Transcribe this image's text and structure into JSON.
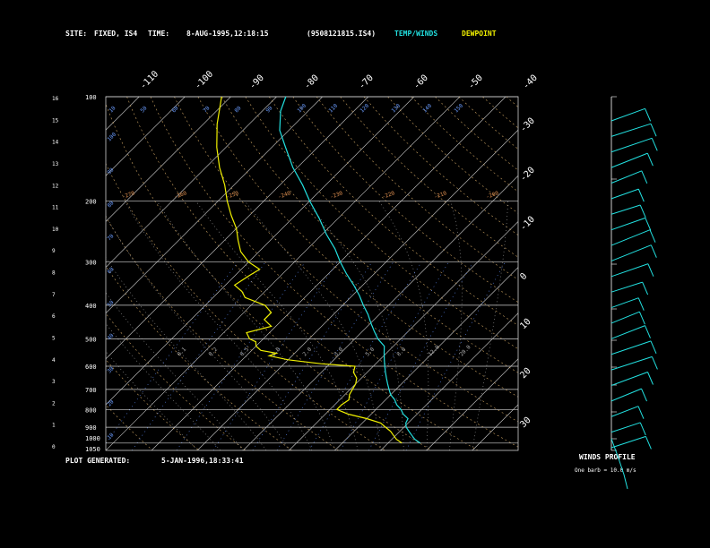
{
  "header": {
    "site_label": "SITE:",
    "site_value": "FIXED, IS4",
    "time_label": "TIME:",
    "time_value": "8-AUG-1995,12:18:15",
    "file_id": "(9508121815.IS4)",
    "legend_temp": "TEMP/WINDS",
    "legend_dew": "DEWPOINT"
  },
  "footer": {
    "generated_label": "PLOT GENERATED:",
    "generated_value": "5-JAN-1996,18:33:41",
    "winds_title": "WINDS PROFILE",
    "winds_note": "One barb = 10.0 m/s"
  },
  "colors": {
    "temp": "#22e0e0",
    "dewpoint": "#f0f000",
    "isotherm": "#cfcfcf",
    "dry_adiabat": "#c8a060",
    "moist_adiabat": "#a0a0a0",
    "mixing_ratio": "#6090ff",
    "isobar": "#cfcfcf"
  },
  "chart_data": {
    "type": "line",
    "subtype": "skew-T log-P sounding",
    "pressure_ticks": [
      "100",
      "200",
      "300",
      "400",
      "500",
      "600",
      "700",
      "800",
      "900",
      "1000",
      "1050"
    ],
    "height_ticks": [
      "0",
      "1",
      "2",
      "3",
      "4",
      "5",
      "6",
      "7",
      "8",
      "9",
      "10",
      "11",
      "12",
      "13",
      "14",
      "15",
      "16"
    ],
    "isotherm_labels_top": [
      "-110",
      "-100",
      "-90",
      "-80",
      "-70",
      "-60",
      "-50",
      "-40"
    ],
    "isotherm_labels_right": [
      "-30",
      "-20",
      "-10",
      "0",
      "10",
      "20",
      "30"
    ],
    "dry_adiabat_labels": [
      "-270",
      "-260",
      "-250",
      "-240",
      "-230",
      "-220",
      "-210",
      "-200"
    ],
    "mixing_ratio_labels_top": [
      "10",
      "50",
      "60",
      "70",
      "80",
      "90",
      "100",
      "110",
      "120",
      "130",
      "140",
      "150"
    ],
    "mixing_ratio_labels_mid": [
      "0.1",
      "0.2",
      "0.5",
      "1.0",
      "2.0",
      "3.0",
      "5.0",
      "8.0",
      "12.0",
      "20.0"
    ],
    "pressure_range": [
      100,
      1050
    ],
    "temp_axis_bottom_range": [
      -40,
      50
    ],
    "temperature": {
      "name": "TEMP/WINDS",
      "points": [
        [
          1000,
          27
        ],
        [
          975,
          25
        ],
        [
          950,
          23.5
        ],
        [
          925,
          22
        ],
        [
          900,
          20.5
        ],
        [
          875,
          19.5
        ],
        [
          850,
          19
        ],
        [
          825,
          17
        ],
        [
          800,
          15.5
        ],
        [
          775,
          13.5
        ],
        [
          750,
          12
        ],
        [
          725,
          10
        ],
        [
          700,
          8.5
        ],
        [
          675,
          7
        ],
        [
          650,
          5.5
        ],
        [
          625,
          4
        ],
        [
          600,
          2.5
        ],
        [
          575,
          1
        ],
        [
          550,
          -0.5
        ],
        [
          525,
          -2
        ],
        [
          500,
          -5
        ],
        [
          475,
          -7.5
        ],
        [
          450,
          -10
        ],
        [
          425,
          -12.5
        ],
        [
          400,
          -15.5
        ],
        [
          375,
          -18.5
        ],
        [
          350,
          -22
        ],
        [
          325,
          -26
        ],
        [
          300,
          -30
        ],
        [
          275,
          -34
        ],
        [
          250,
          -39
        ],
        [
          225,
          -44
        ],
        [
          200,
          -50
        ],
        [
          180,
          -55
        ],
        [
          160,
          -61
        ],
        [
          140,
          -67
        ],
        [
          125,
          -72
        ],
        [
          110,
          -76
        ],
        [
          100,
          -78
        ]
      ]
    },
    "dewpoint": {
      "name": "DEWPOINT",
      "points": [
        [
          1000,
          23
        ],
        [
          975,
          21
        ],
        [
          950,
          19.5
        ],
        [
          925,
          18
        ],
        [
          900,
          16
        ],
        [
          875,
          14
        ],
        [
          850,
          10
        ],
        [
          825,
          5
        ],
        [
          800,
          1.5
        ],
        [
          775,
          1.5
        ],
        [
          750,
          2
        ],
        [
          725,
          1
        ],
        [
          700,
          0.5
        ],
        [
          675,
          0
        ],
        [
          650,
          -1
        ],
        [
          625,
          -3
        ],
        [
          600,
          -4
        ],
        [
          590,
          -12
        ],
        [
          575,
          -20
        ],
        [
          560,
          -25
        ],
        [
          550,
          -24
        ],
        [
          540,
          -28
        ],
        [
          525,
          -30
        ],
        [
          510,
          -31
        ],
        [
          500,
          -33
        ],
        [
          480,
          -35
        ],
        [
          460,
          -31
        ],
        [
          440,
          -34
        ],
        [
          420,
          -34
        ],
        [
          400,
          -37
        ],
        [
          380,
          -43
        ],
        [
          365,
          -45
        ],
        [
          350,
          -48
        ],
        [
          330,
          -47
        ],
        [
          315,
          -46
        ],
        [
          300,
          -50
        ],
        [
          280,
          -54
        ],
        [
          260,
          -57
        ],
        [
          240,
          -60
        ],
        [
          220,
          -64
        ],
        [
          200,
          -68
        ],
        [
          180,
          -72
        ],
        [
          160,
          -77
        ],
        [
          140,
          -82
        ],
        [
          120,
          -87
        ],
        [
          100,
          -92
        ]
      ]
    },
    "wind_barbs_count": 22
  }
}
